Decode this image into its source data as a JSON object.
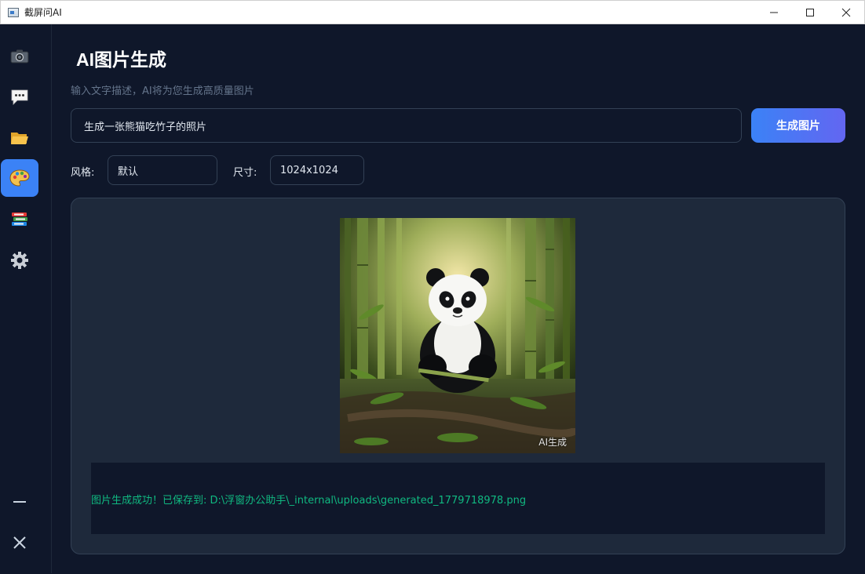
{
  "window": {
    "title": "截屏问AI",
    "controls": {
      "minimize": "—",
      "maximize": "☐",
      "close": "✕"
    }
  },
  "sidebar": {
    "items": [
      {
        "id": "screenshot",
        "icon": "camera-icon",
        "active": false
      },
      {
        "id": "chat",
        "icon": "chat-bubble-icon",
        "active": false
      },
      {
        "id": "files",
        "icon": "folder-icon",
        "active": false
      },
      {
        "id": "image-gen",
        "icon": "palette-icon",
        "active": true
      },
      {
        "id": "history",
        "icon": "books-icon",
        "active": false
      },
      {
        "id": "settings",
        "icon": "gear-icon",
        "active": false
      }
    ],
    "bottom": [
      {
        "id": "minimize",
        "icon": "minimize-icon"
      },
      {
        "id": "close",
        "icon": "close-icon"
      }
    ]
  },
  "main": {
    "title": "AI图片生成",
    "subtitle": "输入文字描述，AI将为您生成高质量图片",
    "prompt_value": "生成一张熊猫吃竹子的照片",
    "generate_label": "生成图片",
    "style_label": "风格:",
    "style_value": "默认",
    "size_label": "尺寸:",
    "size_value": "1024x1024",
    "image_watermark": "AI生成",
    "status_message": "图片生成成功！已保存到: D:\\浮窗办公助手\\_internal\\uploads\\generated_1779718978.png"
  },
  "colors": {
    "background": "#0f172a",
    "panel": "#1e293b",
    "accent": "#3b82f6",
    "accent_end": "#6366f1",
    "success": "#10b981",
    "muted": "#64748b"
  }
}
